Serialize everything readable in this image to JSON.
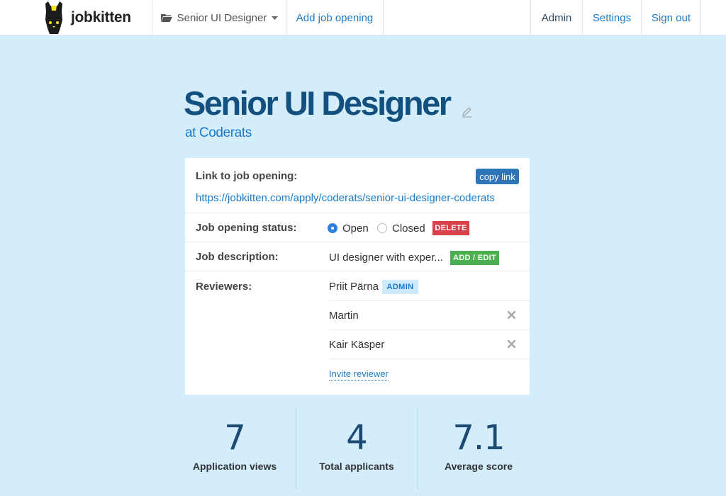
{
  "nav": {
    "brand": "jobkitten",
    "job_selector": "Senior UI Designer",
    "add_job": "Add job opening",
    "admin": "Admin",
    "settings": "Settings",
    "sign_out": "Sign out"
  },
  "job": {
    "title": "Senior UI Designer",
    "company": "at Coderats"
  },
  "card": {
    "link_label": "Link to job opening:",
    "copy_link": "copy link",
    "url": "https://jobkitten.com/apply/coderats/senior-ui-designer-coderats",
    "status_label": "Job opening status:",
    "status_open": "Open",
    "status_closed": "Closed",
    "status_selected": "Open",
    "delete": "DELETE",
    "description_label": "Job description:",
    "description_value": "UI designer with exper...",
    "add_edit": "ADD / EDIT",
    "reviewers_label": "Reviewers:",
    "reviewers": [
      {
        "name": "Priit Pärna",
        "badge": "ADMIN"
      },
      {
        "name": "Martin"
      },
      {
        "name": "Kair Käsper"
      }
    ],
    "invite": "Invite reviewer"
  },
  "stats": [
    {
      "value": "7",
      "label": "Application views"
    },
    {
      "value": "4",
      "label": "Total applicants"
    },
    {
      "value": "7.1",
      "label": "Average score"
    }
  ],
  "colors": {
    "background": "#d3edfb",
    "title": "#11507f",
    "link": "#1a7bcb",
    "delete": "#d9414a",
    "add_edit": "#4cb050",
    "copy": "#2d74b9"
  }
}
